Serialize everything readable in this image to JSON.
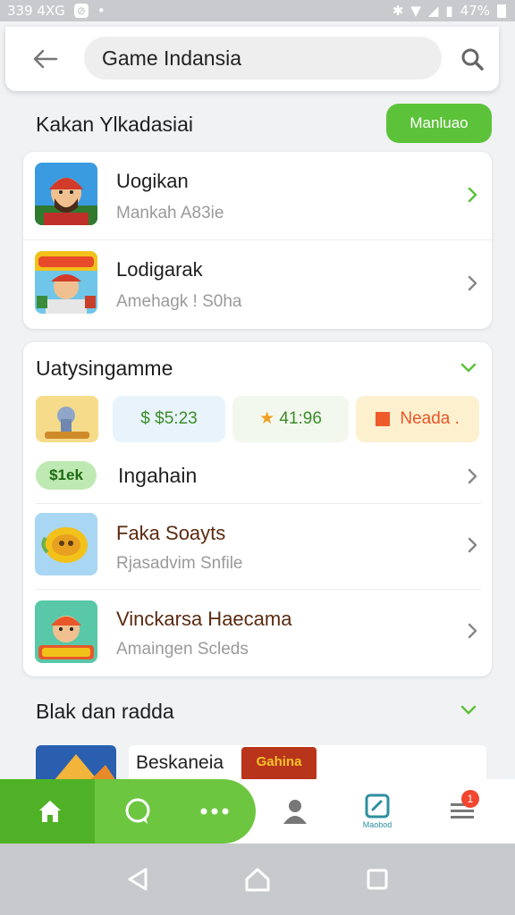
{
  "status_bar": {
    "time_text": "339 4XG",
    "battery_text": "47%"
  },
  "search": {
    "value": "Game Indansia"
  },
  "section1": {
    "title": "Kakan Ylkadasiai",
    "action_label": "Manluao",
    "items": [
      {
        "title": "Uogikan",
        "subtitle": "Mankah A83ie"
      },
      {
        "title": "Lodigarak",
        "subtitle": "Amehagk ! S0ha"
      }
    ]
  },
  "section2": {
    "title": "Uatysingamme",
    "chips": [
      {
        "text": "$5:23",
        "icon": "dollar-icon"
      },
      {
        "text": "41:96",
        "icon": "star-icon"
      },
      {
        "text": "Neada .",
        "icon": "square-icon"
      }
    ],
    "tag": "$1ek",
    "tag_title": "Ingahain",
    "items": [
      {
        "title": "Faka Soayts",
        "subtitle": "Rjasadvim Snfile"
      },
      {
        "title": "Vinckarsa Haecama",
        "subtitle": "Amaingen Scleds"
      }
    ]
  },
  "section3": {
    "title": "Blak dan radda",
    "items": [
      {
        "title": "Beskaneia"
      }
    ],
    "banner_text": "Gahina"
  },
  "bottom_nav": {
    "items": [
      {
        "icon": "home-icon"
      },
      {
        "icon": "chat-icon"
      },
      {
        "icon": "more-icon"
      },
      {
        "icon": "profile-icon"
      },
      {
        "icon": "tasks-icon",
        "label": "Maobod"
      },
      {
        "icon": "menu-icon",
        "badge": "1"
      }
    ]
  },
  "colors": {
    "accent": "#5cc23a",
    "nav_green": "#6cc63f",
    "badge": "#f2462f"
  }
}
